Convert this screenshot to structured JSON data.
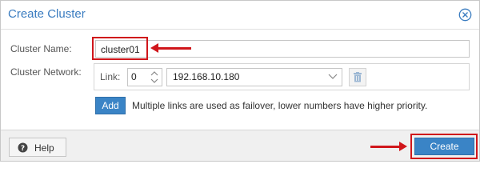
{
  "dialog": {
    "title": "Create Cluster",
    "close_icon": "close-circle-icon"
  },
  "form": {
    "cluster_name_label": "Cluster Name:",
    "cluster_name_value": "cluster01",
    "cluster_network_label": "Cluster Network:",
    "link_label": "Link:",
    "link_value": "0",
    "link_address": "192.168.10.180",
    "add_label": "Add",
    "hint": "Multiple links are used as failover, lower numbers have higher priority."
  },
  "footer": {
    "help_label": "Help",
    "create_label": "Create"
  },
  "colors": {
    "title": "#3a7cc0",
    "primary_button": "#3a84c6",
    "annotation_red": "#d0161b"
  },
  "icons": [
    "close-circle-icon",
    "spinner-updown-icon",
    "chevron-down-icon",
    "trash-icon",
    "help-circle-icon",
    "red-arrow-annotation"
  ]
}
